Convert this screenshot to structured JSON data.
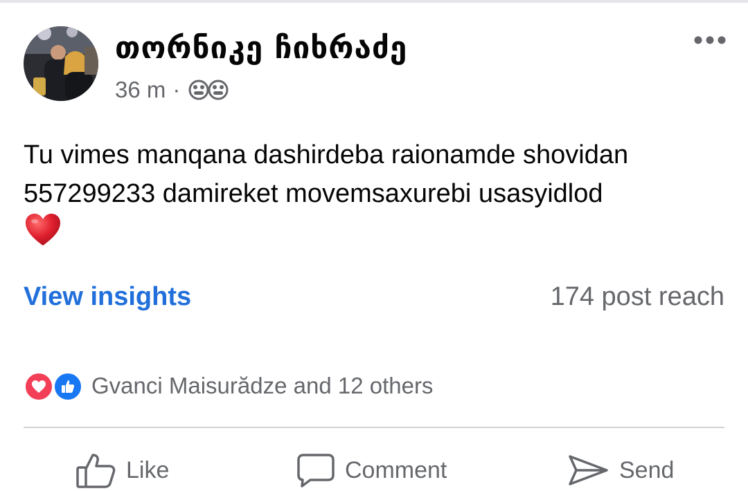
{
  "post": {
    "author_name": "თორნიკე ჩიხრაძე",
    "time": "36 m",
    "separator": "·",
    "audience_icon": "friends-icon",
    "text_line1": "Tu vimes manqana dashirdeba raionamde shovidan",
    "text_line2": "557299233 damireket movemsaxurebi usasyidlod",
    "emoji": "heart-emoji",
    "more_icon": "more-dots-icon"
  },
  "insights": {
    "link_label": "View insights",
    "reach_text": "174 post reach"
  },
  "reactions": {
    "icons": [
      "love-reaction-icon",
      "like-reaction-icon"
    ],
    "summary": "Gvanci Maisurădze and 12 others"
  },
  "actions": {
    "like_label": "Like",
    "comment_label": "Comment",
    "send_label": "Send"
  },
  "colors": {
    "link_blue": "#216fdb",
    "secondary_text": "#65676b",
    "love_red": "#f33e58",
    "like_blue": "#1877f2"
  }
}
